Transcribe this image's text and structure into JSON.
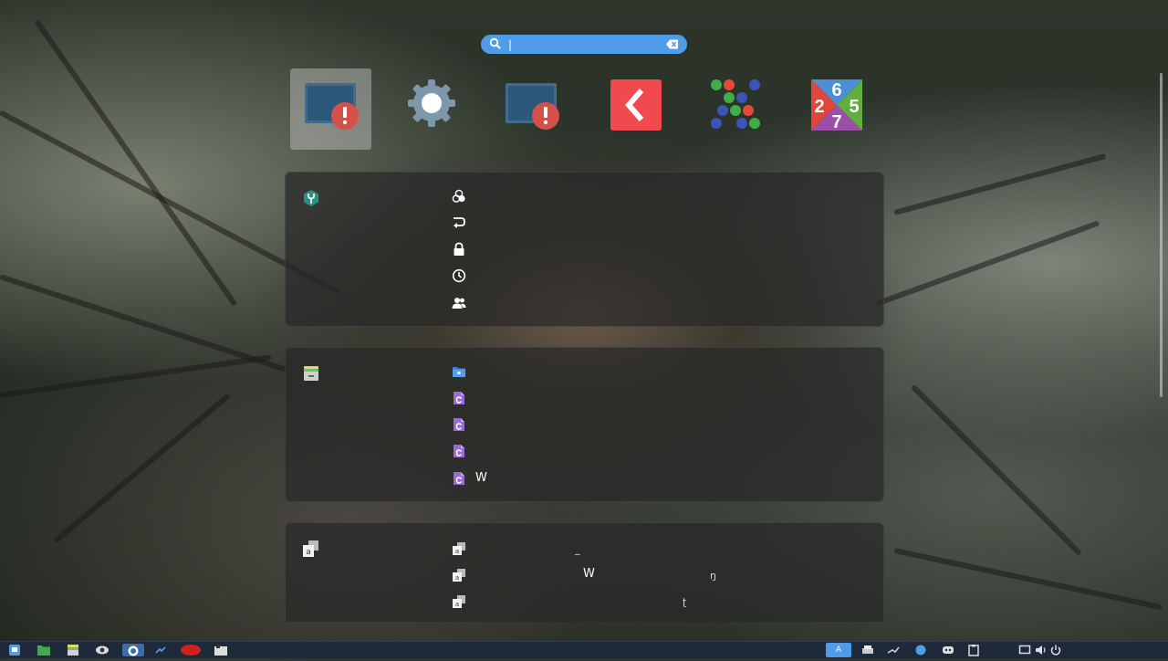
{
  "search": {
    "value": "|",
    "placeholder": ""
  },
  "apps": [
    {
      "name": "app-missing-1"
    },
    {
      "name": "settings"
    },
    {
      "name": "app-missing-2"
    },
    {
      "name": "flutter-app"
    },
    {
      "name": "dots-game"
    },
    {
      "name": "sudoku-275"
    }
  ],
  "sudoku_digits": [
    "6",
    "2",
    "5",
    "7"
  ],
  "settings_section": {
    "rows": [
      {
        "icon": "appearance-icon",
        "label": ""
      },
      {
        "icon": "redo-icon",
        "label": ""
      },
      {
        "icon": "lock-icon",
        "label": ""
      },
      {
        "icon": "clock-icon",
        "label": ""
      },
      {
        "icon": "users-icon",
        "label": ""
      }
    ]
  },
  "files_section": {
    "rows": [
      {
        "icon": "folder-icon",
        "label": ""
      },
      {
        "icon": "file-c-icon",
        "label": ""
      },
      {
        "icon": "file-c-icon",
        "label": ""
      },
      {
        "icon": "file-c-icon",
        "label": ""
      },
      {
        "icon": "file-c-icon",
        "label": "W"
      }
    ]
  },
  "chars_section": {
    "rows": [
      {
        "icon": "character-icon",
        "mid": "_",
        "right": ""
      },
      {
        "icon": "character-icon",
        "mid": "W",
        "right": "ŋ"
      },
      {
        "icon": "character-icon",
        "mid": "",
        "right": "ʈ"
      }
    ]
  },
  "taskbar": {
    "keyboard_label": "A"
  },
  "colors": {
    "accent": "#4f9de8",
    "panel": "#2a2a2a",
    "taskbar": "#1e2a3a"
  }
}
